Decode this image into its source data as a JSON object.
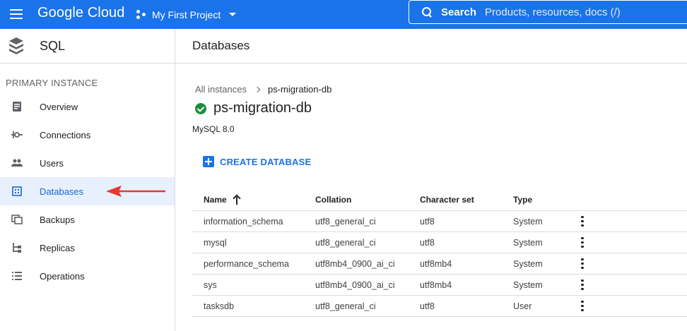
{
  "topbar": {
    "logo": "Google Cloud",
    "project": "My First Project",
    "search_label": "Search",
    "search_placeholder": "Products, resources, docs (/)"
  },
  "sidebar": {
    "title": "SQL",
    "section": "PRIMARY INSTANCE",
    "items": [
      {
        "label": "Overview",
        "icon": "overview-icon"
      },
      {
        "label": "Connections",
        "icon": "connections-icon"
      },
      {
        "label": "Users",
        "icon": "users-icon"
      },
      {
        "label": "Databases",
        "icon": "databases-icon",
        "active": true
      },
      {
        "label": "Backups",
        "icon": "backups-icon"
      },
      {
        "label": "Replicas",
        "icon": "replicas-icon"
      },
      {
        "label": "Operations",
        "icon": "operations-icon"
      }
    ]
  },
  "main": {
    "header": "Databases",
    "breadcrumb": {
      "parent": "All instances",
      "current": "ps-migration-db"
    },
    "instance_name": "ps-migration-db",
    "instance_version": "MySQL 8.0",
    "create_button": "CREATE DATABASE",
    "table": {
      "columns": [
        "Name",
        "Collation",
        "Character set",
        "Type"
      ],
      "rows": [
        [
          "information_schema",
          "utf8_general_ci",
          "utf8",
          "System"
        ],
        [
          "mysql",
          "utf8_general_ci",
          "utf8",
          "System"
        ],
        [
          "performance_schema",
          "utf8mb4_0900_ai_ci",
          "utf8mb4",
          "System"
        ],
        [
          "sys",
          "utf8mb4_0900_ai_ci",
          "utf8mb4",
          "System"
        ],
        [
          "tasksdb",
          "utf8_general_ci",
          "utf8",
          "User"
        ]
      ]
    }
  },
  "colors": {
    "brand": "#1a73e8",
    "active_bg": "#e8f0fe",
    "status_ok": "#1e8e3e",
    "annotation_arrow": "#e53935"
  }
}
